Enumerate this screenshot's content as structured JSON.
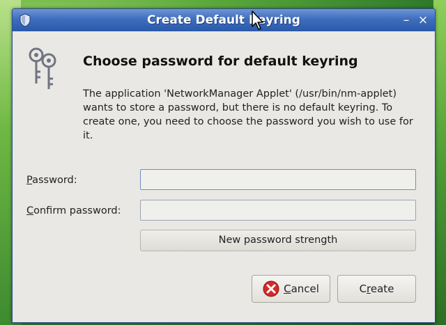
{
  "window": {
    "title": "Create Default Keyring",
    "minimize_label": "–",
    "close_label": "×"
  },
  "dialog": {
    "heading": "Choose password for default keyring",
    "description": "The application 'NetworkManager Applet' (/usr/bin/nm-applet) wants to store a password, but there is no default keyring. To create one, you need to choose the password you wish to use for it.",
    "password_label_mnemonic": "P",
    "password_label_rest": "assword:",
    "password_value": "",
    "confirm_label_mnemonic": "C",
    "confirm_label_rest": "onfirm password:",
    "confirm_value": "",
    "strength_label": "New password strength",
    "strength_fraction": 0,
    "cancel_label_mnemonic": "C",
    "cancel_label_rest": "ancel",
    "create_label_start": "C",
    "create_label_mnemonic": "r",
    "create_label_rest": "eate"
  },
  "colors": {
    "titlebar": "#3e6ec0",
    "window_bg": "#e9e8e4",
    "cancel_icon": "#d42a2a"
  },
  "icons": {
    "titlebar": "shield-icon",
    "dialog": "keys-icon",
    "cancel": "cancel-icon"
  }
}
